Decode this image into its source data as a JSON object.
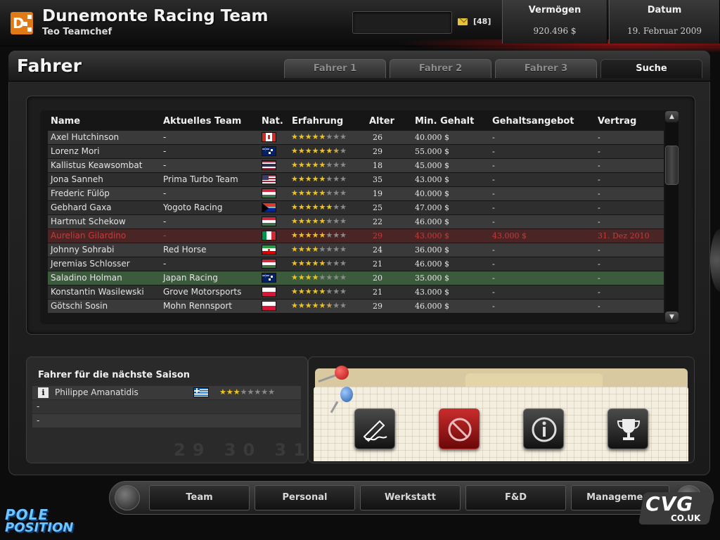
{
  "header": {
    "team_name": "Dunemonte Racing Team",
    "team_chief": "Teo Teamchef",
    "message_count": "[48]",
    "wealth_label": "Vermögen",
    "wealth_value": "920.496 $",
    "date_label": "Datum",
    "date_value": "19. Februar 2009"
  },
  "page": {
    "title": "Fahrer",
    "tabs": [
      "Fahrer 1",
      "Fahrer 2",
      "Fahrer 3",
      "Suche"
    ],
    "active_tab": "Suche"
  },
  "table": {
    "columns": [
      "Name",
      "Aktuelles Team",
      "Nat.",
      "Erfahrung",
      "Alter",
      "Min. Gehalt",
      "Gehaltsangebot",
      "Vertrag"
    ],
    "rows": [
      {
        "name": "Axel Hutchinson",
        "team": "-",
        "flag": "canada-flag-icon",
        "stars": 5.0,
        "age": "26",
        "min_salary": "40.000 $",
        "offer": "-",
        "contract": "-"
      },
      {
        "name": "Lorenz Mori",
        "team": "-",
        "flag": "australia-flag-icon",
        "stars": 6.5,
        "age": "29",
        "min_salary": "55.000 $",
        "offer": "-",
        "contract": "-"
      },
      {
        "name": "Kallistus Keawsombat",
        "team": "-",
        "flag": "thailand-flag-icon",
        "stars": 5.0,
        "age": "18",
        "min_salary": "45.000 $",
        "offer": "-",
        "contract": "-"
      },
      {
        "name": "Jona Sanneh",
        "team": "Prima Turbo Team",
        "flag": "usa-flag-icon",
        "stars": 5.0,
        "age": "35",
        "min_salary": "43.000 $",
        "offer": "-",
        "contract": "-"
      },
      {
        "name": "Frederic Fülöp",
        "team": "-",
        "flag": "hungary-flag-icon",
        "stars": 5.0,
        "age": "19",
        "min_salary": "40.000 $",
        "offer": "-",
        "contract": "-"
      },
      {
        "name": "Gebhard Gaxa",
        "team": "Yogoto Racing",
        "flag": "south-africa-flag-icon",
        "stars": 6.0,
        "age": "25",
        "min_salary": "47.000 $",
        "offer": "-",
        "contract": "-"
      },
      {
        "name": "Hartmut Schekow",
        "team": "-",
        "flag": "hungary-flag-icon",
        "stars": 5.0,
        "age": "22",
        "min_salary": "46.000 $",
        "offer": "-",
        "contract": "-"
      },
      {
        "name": "Aurelian Gilardino",
        "team": "-",
        "flag": "italy-flag-icon",
        "stars": 5.0,
        "age": "29",
        "min_salary": "43.000 $",
        "offer": "43.000 $",
        "contract": "31. Dez 2010",
        "highlight": "red"
      },
      {
        "name": "Johnny Sohrabi",
        "team": "Red Horse",
        "flag": "iran-flag-icon",
        "stars": 4.0,
        "age": "24",
        "min_salary": "36.000 $",
        "offer": "-",
        "contract": "-"
      },
      {
        "name": "Jeremias Schlosser",
        "team": "-",
        "flag": "hungary-flag-icon",
        "stars": 5.0,
        "age": "21",
        "min_salary": "46.000 $",
        "offer": "-",
        "contract": "-"
      },
      {
        "name": "Saladino Holman",
        "team": "Japan Racing",
        "flag": "australia-flag-icon",
        "stars": 4.0,
        "age": "20",
        "min_salary": "35.000 $",
        "offer": "-",
        "contract": "-",
        "highlight": "green"
      },
      {
        "name": "Konstantin Wasilewski",
        "team": "Grove Motorsports",
        "flag": "poland-flag-icon",
        "stars": 5.0,
        "age": "21",
        "min_salary": "43.000 $",
        "offer": "-",
        "contract": "-"
      },
      {
        "name": "Götschi Sosin",
        "team": "Mohn Rennsport",
        "flag": "poland-flag-icon",
        "stars": 5.5,
        "age": "29",
        "min_salary": "46.000 $",
        "offer": "-",
        "contract": "-"
      }
    ]
  },
  "next_season": {
    "title": "Fahrer für die nächste Saison",
    "rows": [
      {
        "name": "Philippe Amanatidis",
        "flag": "greece-flag-icon",
        "stars": 3.0
      },
      {
        "name": "-"
      },
      {
        "name": "-"
      }
    ],
    "calendar_days": "29 30 31"
  },
  "actions": [
    "sign-contract-icon",
    "cancel-icon",
    "info-icon",
    "trophy-icon"
  ],
  "nav": {
    "items": [
      "Team",
      "Personal",
      "Werkstatt",
      "F&D",
      "Management"
    ]
  },
  "branding": {
    "game_logo_line1": "POLE",
    "game_logo_line2": "POSITION",
    "site_logo": "CVG",
    "site_logo_sub": "CO.UK"
  },
  "colors": {
    "accent_orange": "#e07a16",
    "star_gold": "#f0c419",
    "highlight_red_text": "#c83a3a",
    "highlight_green_row": "#3c5a3c"
  }
}
